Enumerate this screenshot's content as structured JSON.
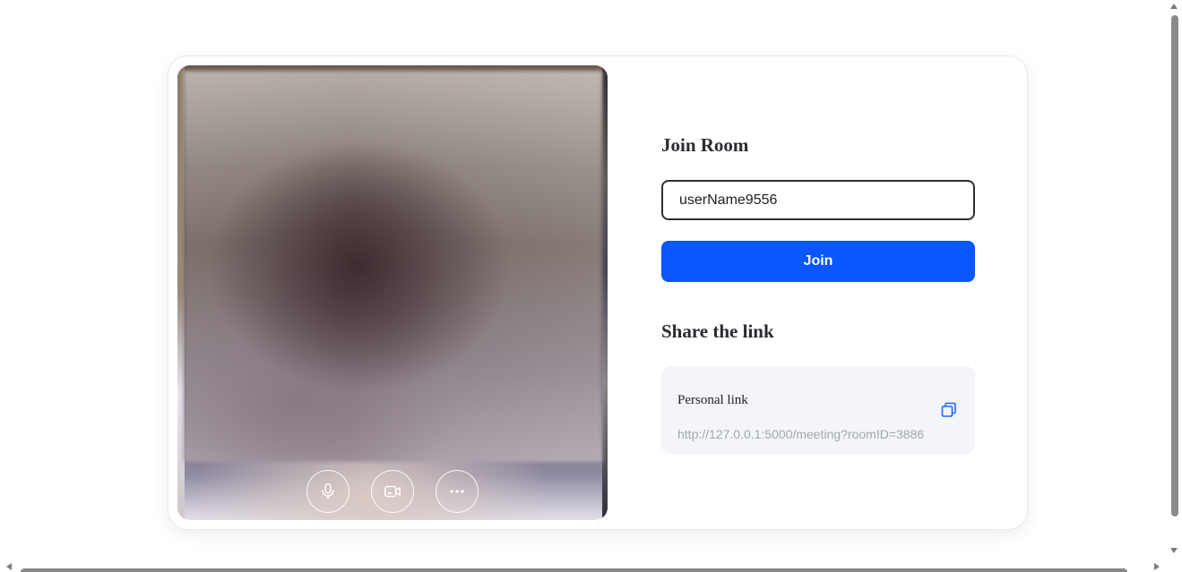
{
  "join": {
    "title": "Join Room",
    "username_value": "userName9556",
    "button_label": "Join"
  },
  "share": {
    "title": "Share the link",
    "personal_link_label": "Personal link",
    "url": "http://127.0.0.1:5000/meeting?roomID=3886"
  },
  "controls": [
    {
      "icon": "microphone-icon"
    },
    {
      "icon": "video-camera-icon"
    },
    {
      "icon": "more-options-icon"
    }
  ],
  "colors": {
    "primary": "#0a57ff",
    "link_box_bg": "#f4f5f9",
    "copy_icon": "#1a66ff"
  }
}
